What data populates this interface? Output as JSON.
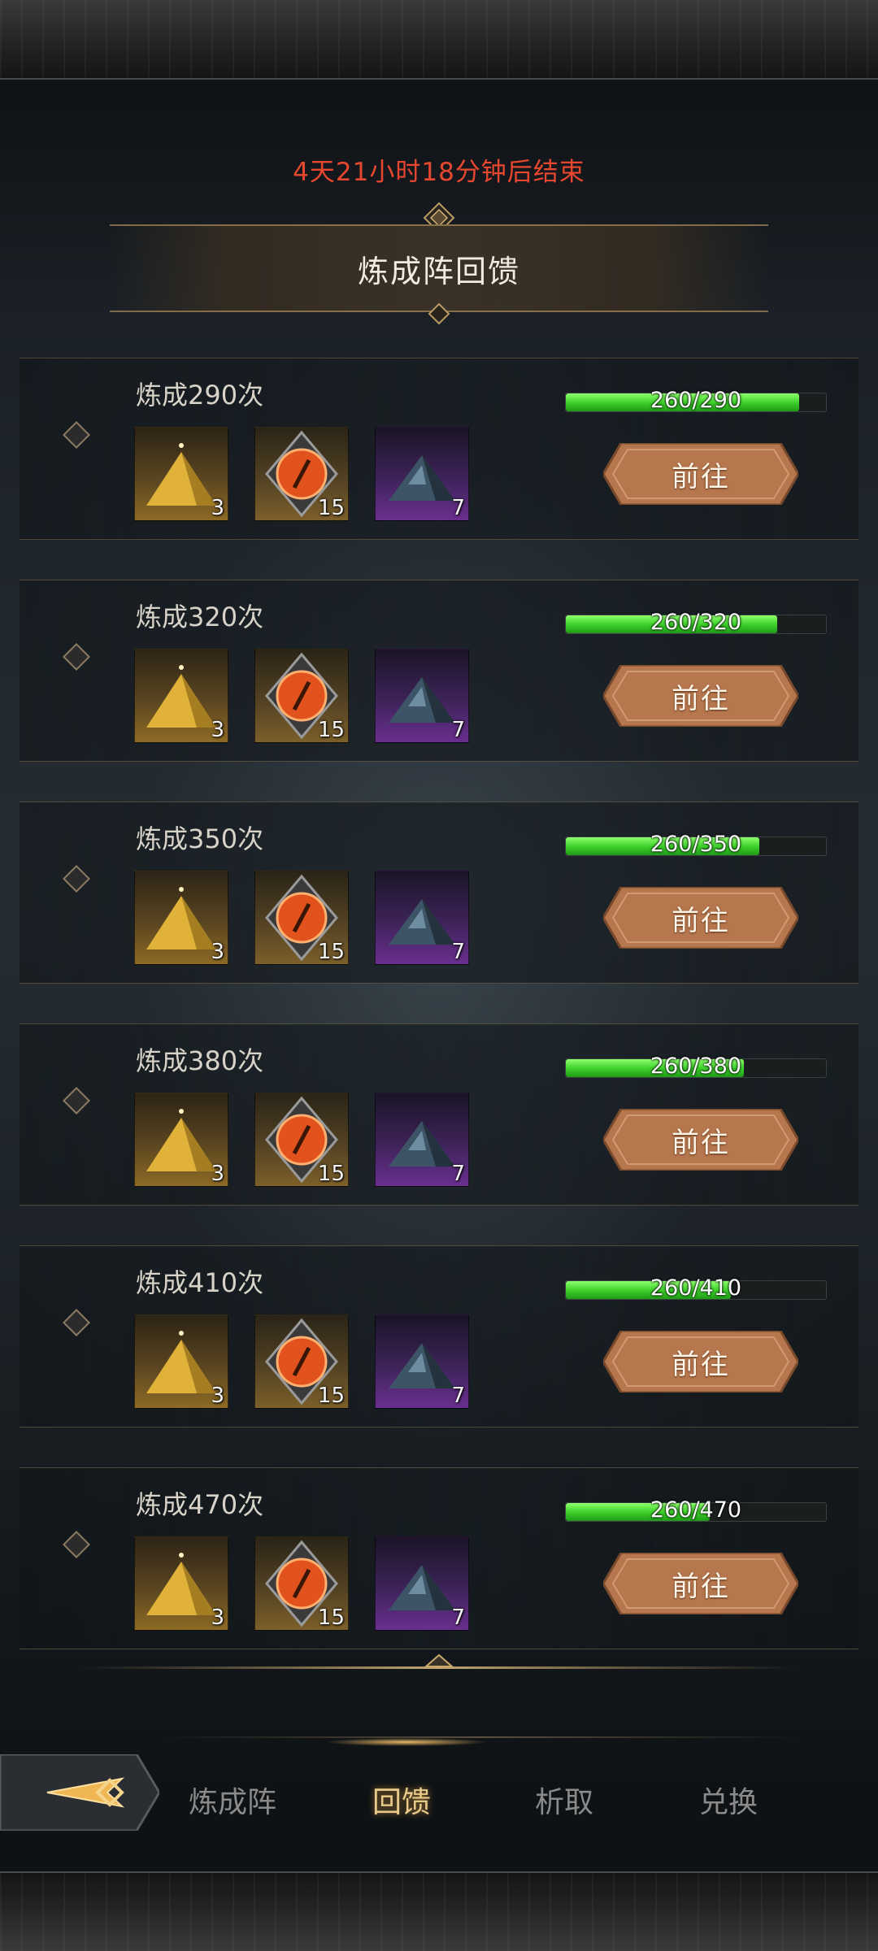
{
  "timer_text": "4天21小时18分钟后结束",
  "page_title": "炼成阵回馈",
  "rewards": [
    {
      "label": "炼成290次",
      "progress_text": "260/290",
      "progress": 0.897,
      "items": [
        {
          "kind": "gold",
          "count": "3"
        },
        {
          "kind": "bronze",
          "count": "15"
        },
        {
          "kind": "purple",
          "count": "7"
        }
      ],
      "button": "前往"
    },
    {
      "label": "炼成320次",
      "progress_text": "260/320",
      "progress": 0.8125,
      "items": [
        {
          "kind": "gold",
          "count": "3"
        },
        {
          "kind": "bronze",
          "count": "15"
        },
        {
          "kind": "purple",
          "count": "7"
        }
      ],
      "button": "前往"
    },
    {
      "label": "炼成350次",
      "progress_text": "260/350",
      "progress": 0.743,
      "items": [
        {
          "kind": "gold",
          "count": "3"
        },
        {
          "kind": "bronze",
          "count": "15"
        },
        {
          "kind": "purple",
          "count": "7"
        }
      ],
      "button": "前往"
    },
    {
      "label": "炼成380次",
      "progress_text": "260/380",
      "progress": 0.684,
      "items": [
        {
          "kind": "gold",
          "count": "3"
        },
        {
          "kind": "bronze",
          "count": "15"
        },
        {
          "kind": "purple",
          "count": "7"
        }
      ],
      "button": "前往"
    },
    {
      "label": "炼成410次",
      "progress_text": "260/410",
      "progress": 0.634,
      "items": [
        {
          "kind": "gold",
          "count": "3"
        },
        {
          "kind": "bronze",
          "count": "15"
        },
        {
          "kind": "purple",
          "count": "7"
        }
      ],
      "button": "前往"
    },
    {
      "label": "炼成470次",
      "progress_text": "260/470",
      "progress": 0.553,
      "items": [
        {
          "kind": "gold",
          "count": "3"
        },
        {
          "kind": "bronze",
          "count": "15"
        },
        {
          "kind": "purple",
          "count": "7"
        }
      ],
      "button": "前往"
    }
  ],
  "tabs": [
    "炼成阵",
    "回馈",
    "析取",
    "兑换"
  ],
  "active_tab": "回馈",
  "icons": {
    "back": "back-arrow-icon",
    "gold": "gold-powder-pile-icon",
    "bronze": "orange-rune-orb-icon",
    "purple": "dark-crystal-pile-icon"
  },
  "colors": {
    "timer": "#e8472f",
    "progress_fill": "#3fd32c",
    "button": "#b7774e",
    "active_tab": "#e8c98a"
  }
}
